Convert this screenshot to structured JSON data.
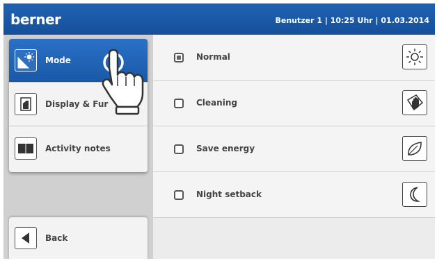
{
  "header": {
    "brand": "berner",
    "status": "Benutzer 1 | 10:25 Uhr | 01.03.2014"
  },
  "menu": {
    "items": [
      {
        "label": "Mode",
        "icon": "mode-icon",
        "active": true
      },
      {
        "label": "Display & Functions",
        "visible_label": "Display & Fur",
        "visible_label_tail": "n",
        "icon": "display-icon",
        "active": false
      },
      {
        "label": "Activity notes",
        "icon": "book-icon",
        "active": false
      }
    ],
    "back_label": "Back"
  },
  "options": [
    {
      "label": "Normal",
      "checked": true,
      "icon": "sun-icon"
    },
    {
      "label": "Cleaning",
      "checked": false,
      "icon": "cleaning-hand-icon"
    },
    {
      "label": "Save energy",
      "checked": false,
      "icon": "leaf-icon"
    },
    {
      "label": "Night setback",
      "checked": false,
      "icon": "moon-icon"
    }
  ],
  "colors": {
    "header_blue": "#1a58a8",
    "active_blue": "#2a71c6"
  }
}
